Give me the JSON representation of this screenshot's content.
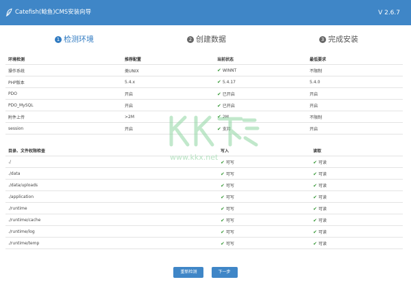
{
  "header": {
    "title": "Catefish(鲶鱼)CMS安装向导",
    "version": "V 2.6.7"
  },
  "steps": [
    {
      "num": "1",
      "label": "检测环境"
    },
    {
      "num": "2",
      "label": "创建数据"
    },
    {
      "num": "3",
      "label": "完成安装"
    }
  ],
  "env": {
    "headers": [
      "环境检测",
      "推荐配置",
      "当前状态",
      "最低要求"
    ],
    "rows": [
      [
        "操作系统",
        "类UNIX",
        "WINNT",
        "不限制"
      ],
      [
        "PHP版本",
        "5.4.x",
        "5.4.17",
        "5.4.0"
      ],
      [
        "PDO",
        "开启",
        "已开启",
        "开启"
      ],
      [
        "PDO_MySQL",
        "开启",
        "已开启",
        "开启"
      ],
      [
        "附件上传",
        ">2M",
        "2M",
        "不限制"
      ],
      [
        "session",
        "开启",
        "支持",
        "开启"
      ]
    ]
  },
  "perm": {
    "headers": [
      "目录、文件权限检查",
      "写入",
      "读取"
    ],
    "rows": [
      [
        "./",
        "可写",
        "可读"
      ],
      [
        "./data",
        "可写",
        "可读"
      ],
      [
        "./data/uploads",
        "可写",
        "可读"
      ],
      [
        "./application",
        "可写",
        "可读"
      ],
      [
        "./runtime",
        "可写",
        "可读"
      ],
      [
        "./runtime/cache",
        "可写",
        "可读"
      ],
      [
        "./runtime/log",
        "可写",
        "可读"
      ],
      [
        "./runtime/temp",
        "可写",
        "可读"
      ]
    ]
  },
  "buttons": {
    "recheck": "重新检测",
    "next": "下一步"
  },
  "watermark": {
    "logo": "KK下载",
    "url": "www.kkx.net"
  },
  "colors": {
    "header": "#3f86c7",
    "accent": "#2f7ac1",
    "ok": "#3a9a3a"
  },
  "icons": {
    "logo": "leaf-icon",
    "check": "check-icon",
    "step": "step-number-icon"
  }
}
